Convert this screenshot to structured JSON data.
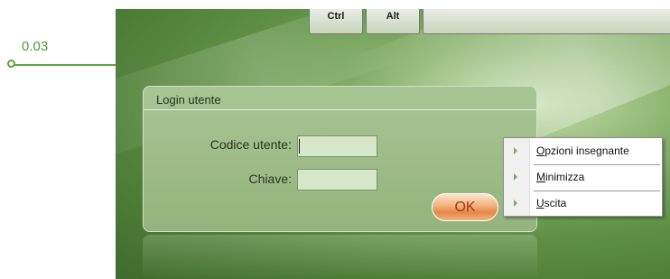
{
  "annotation": {
    "value": "0.03"
  },
  "keyboard": {
    "ctrl_label": "Ctrl",
    "alt_label": "Alt"
  },
  "login": {
    "title": "Login utente",
    "user_label": "Codice utente:",
    "user_value": "",
    "key_label": "Chiave:",
    "key_value": "",
    "ok_label": "OK"
  },
  "context_menu": {
    "items": [
      {
        "mnemonic": "O",
        "rest": "pzioni insegnante"
      },
      {
        "mnemonic": "M",
        "rest": "inimizza"
      },
      {
        "mnemonic": "U",
        "rest": "scita"
      }
    ]
  },
  "colors": {
    "accent_green": "#5aa63c",
    "ok_text": "#9c3a14",
    "panel": "#9fbe8a"
  }
}
